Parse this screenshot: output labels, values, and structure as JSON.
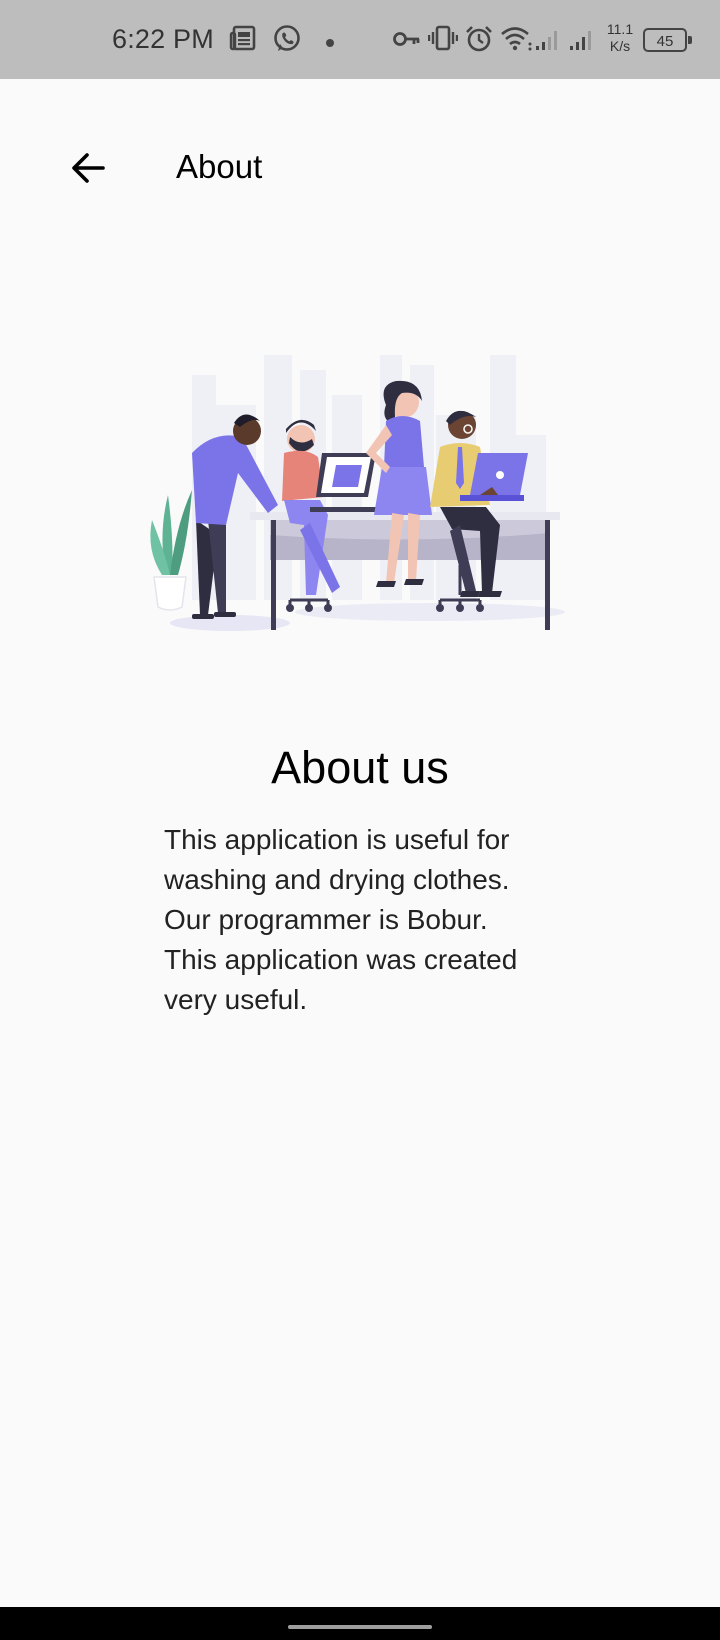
{
  "status_bar": {
    "time": "6:22 PM",
    "net_speed_value": "11.1",
    "net_speed_unit": "K/s",
    "battery_level": "45",
    "icons": [
      "news-icon",
      "whatsapp-icon",
      "notification-dot-icon",
      "vpn-key-icon",
      "vibrate-icon",
      "alarm-icon",
      "wifi-icon",
      "signal-sim1-icon",
      "signal-sim2-icon",
      "battery-icon"
    ]
  },
  "app_bar": {
    "back_icon": "arrow-left-icon",
    "title": "About"
  },
  "illustration": {
    "subject": "team-collaboration-illustration",
    "colors": {
      "accent": "#7b73e8",
      "plant": "#5fb395",
      "table": "#b7b3c8",
      "skyline": "#eef0f5"
    }
  },
  "content": {
    "heading": "About us",
    "lines": [
      "This application is useful for",
      "washing and drying clothes.",
      "Our programmer is Bobur.",
      "This application was created",
      "very useful."
    ]
  },
  "colors": {
    "status_bar_bg": "#bdbdbd",
    "page_bg": "#fafafa",
    "nav_bar_bg": "#000000"
  }
}
